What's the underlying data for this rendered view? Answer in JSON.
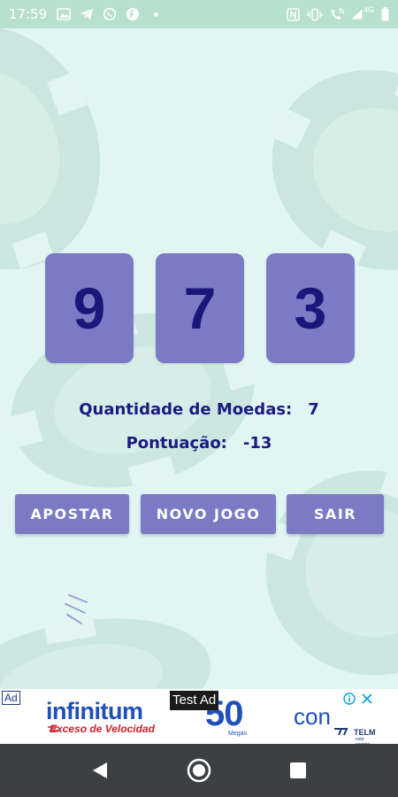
{
  "status_bar": {
    "time": "17:59",
    "network_label": "4G"
  },
  "game": {
    "reels": [
      "9",
      "7",
      "3"
    ],
    "coins_label": "Quantidade de Moedas:",
    "coins_value": "7",
    "score_label": "Pontuação:",
    "score_value": "-13"
  },
  "buttons": {
    "bet": "APOSTAR",
    "new_game": "NOVO JOGO",
    "exit": "SAIR"
  },
  "ad": {
    "badge": "Ad",
    "test_label": "Test Ad",
    "title": "infinitum",
    "slogan": "Exceso de Velocidad",
    "number": "50",
    "unit": "Megas",
    "connector": "con",
    "brand": "TELMEX",
    "brand_sub": "está contigo"
  },
  "icons": {
    "status_left": [
      "gallery-icon",
      "telegram-icon",
      "whatsapp-icon",
      "app-icon",
      "dot-icon"
    ],
    "status_right": [
      "nfc-icon",
      "vibrate-icon",
      "wifi-call-icon",
      "signal-icon",
      "battery-icon"
    ],
    "nav": [
      "back-icon",
      "home-icon",
      "recents-icon"
    ],
    "ad": [
      "info-icon",
      "close-icon"
    ]
  },
  "colors": {
    "status_bar": "#b7e0cf",
    "background": "#e1f6f3",
    "reel": "#7a7bc4",
    "reel_digit": "#1a177a",
    "text": "#1a1a80",
    "button": "#7a7bc4",
    "nav_bar": "#3c4043"
  }
}
